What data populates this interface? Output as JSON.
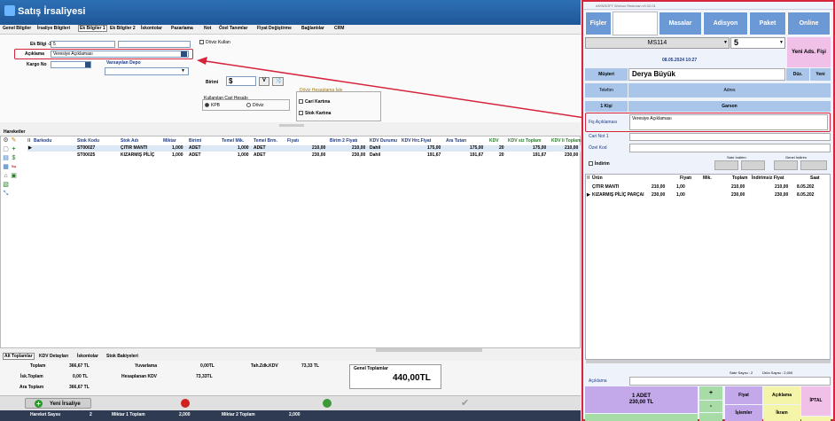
{
  "left": {
    "title": "Satış İrsaliyesi",
    "tabs": [
      "Genel Bilgiler",
      "İrsaliye Bilgileri",
      "Ek Bilgiler 1",
      "Ek Bilgiler 2",
      "İskontolar",
      "Pazarlama",
      "Not",
      "Özel Tanımlar",
      "Fiyat Değiştirme",
      "Bağlantılar",
      "CRM"
    ],
    "form": {
      "ek_bilgi_label": "Ek Bilgi -1/2",
      "ek_bilgi_value": "5",
      "aciklama_label": "Açıklama",
      "aciklama_value": "Veresiye Açıklaması",
      "kargo_label": "Kargo No",
      "varsayilan_depo": "Varsayılan Depo",
      "doviz_kullan": "Döviz Kullan",
      "birimi_label": "Birimi",
      "birimi_value": "$",
      "cari_hesabi": "Kullanılan Cari Hesabı",
      "kpb": "KPB",
      "doviz": "Döviz",
      "doviz_hesablama": "Döviz Hesaplama İşle",
      "cari_kartina": "Cari Kartına",
      "stok_kartina": "Stok Kartına"
    },
    "grid": {
      "label": "Hareketler",
      "headers": [
        "Barkodu",
        "Stok Kodu",
        "Stok Adı",
        "Miktar",
        "Birimi",
        "Temel Mik.",
        "Temel Brm.",
        "Fiyatı",
        "Birim 2 Fiyatı",
        "KDV Durumu",
        "KDV Hrc.Fiyat",
        "Ara Tutarı",
        "KDV",
        "KDV siz Toplam",
        "KDV li Toplam"
      ],
      "rows": [
        [
          "",
          "ST00027",
          "ÇITIR MANTI",
          "1,000",
          "ADET",
          "1,000",
          "ADET",
          "210,00",
          "210,00",
          "Dahil",
          "175,00",
          "175,00",
          "20",
          "175,00",
          "210,00"
        ],
        [
          "",
          "ST00025",
          "KIZARMIŞ PİLİÇ",
          "1,000",
          "ADET",
          "1,000",
          "ADET",
          "230,00",
          "230,00",
          "Dahil",
          "191,67",
          "191,67",
          "20",
          "191,67",
          "230,00"
        ]
      ]
    },
    "bottom_tabs": [
      "Alt Toplamlar",
      "KDV Detayları",
      "İskontolar",
      "Stok Bakiyeleri"
    ],
    "totals": {
      "toplam_l": "Toplam",
      "toplam_v": "366,67 TL",
      "isk_l": "İsk.Toplam",
      "isk_v": "0,00 TL",
      "ara_l": "Ara Toplam",
      "ara_v": "366,67 TL",
      "yuv_l": "Yuvarlama",
      "yuv_v": "0,00TL",
      "hkdv_l": "Hesaplanan KDV",
      "hkdv_v": "73,33TL",
      "tah_l": "Tah.Zdk.KDV",
      "tah_v": "73,33 TL",
      "genel_l": "Genel Toplamlar",
      "genel_v": "440,00TL"
    },
    "yeni_irsaliye": "Yeni İrsaliye",
    "footer": {
      "hareket_l": "Hareket Sayısı",
      "hareket_v": "2",
      "m1_l": "Miktar 1 Toplam",
      "m1_v": "2,000",
      "m2_l": "Miktar 2 Toplam",
      "m2_v": "2,000"
    }
  },
  "right": {
    "title": "AKINSOFT Wolvox Restoran v9.02.01",
    "top_buttons": [
      "Fişler",
      "Masalar",
      "Adisyon",
      "Paket",
      "Online"
    ],
    "masa": "MS114",
    "kisi": "5",
    "yeni_ads": "Yeni Ads. Fişi",
    "datetime": "08.05.2024 10:27",
    "musteri_l": "Müşteri",
    "musteri_v": "Derya Büyük",
    "duz": "Düz.",
    "yeni": "Yeni",
    "telefon": "Telefon",
    "adres": "Adres",
    "kisi_l": "1 Kişi",
    "garson": "Garson",
    "fis_aciklama_l": "Fiş Açıklaması",
    "fis_aciklama_v": "Veresiye Açıklaması",
    "cari_not": "Cari Not 1",
    "ozel_kod": "Özel Kod",
    "indirim": "İndirim",
    "satir_indirim": "Satır İndirim",
    "genel_indirim": "Genel İndirim",
    "grid_headers": [
      "Ürün",
      "Fiyatı",
      "Mik.",
      "Toplam",
      "İndirimsiz Fiyat",
      "Saat"
    ],
    "grid_rows": [
      [
        "ÇITIR MANTI",
        "210,00",
        "1,00",
        "210,00",
        "210,00",
        "8.05.202"
      ],
      [
        "KIZARMIŞ PİLİÇ PARÇAI",
        "230,00",
        "1,00",
        "230,00",
        "230,00",
        "8.05.202"
      ]
    ],
    "satir_sayisi": "Satır Sayısı : 2",
    "urun_sayisi": "Ürün Sayısı : 2,000",
    "aciklama_l": "Açıklama",
    "adet_line": "1 ADET",
    "adet_price": "230,00 TL",
    "fiyat": "Fiyat",
    "aciklama_b": "Açıklama",
    "iptal": "İPTAL",
    "islemler": "İşlemler",
    "ikram": "İkram",
    "plus": "+",
    "minus": "-"
  }
}
